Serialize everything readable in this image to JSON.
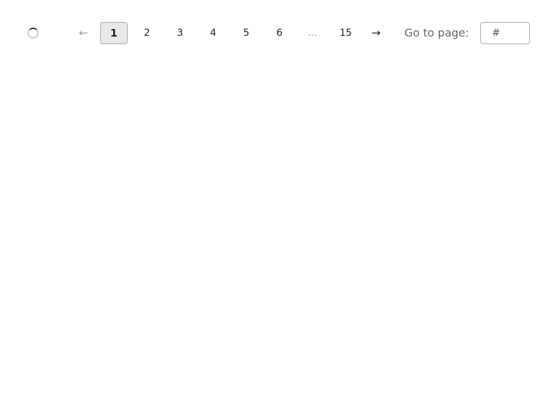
{
  "pagination": {
    "prev": "←",
    "next": "→",
    "pages": [
      "1",
      "2",
      "3",
      "4",
      "5",
      "6"
    ],
    "ellipsis": "...",
    "last_page": "15",
    "current_page": "1",
    "goto_label": "Go to page:",
    "goto_placeholder": "#"
  }
}
